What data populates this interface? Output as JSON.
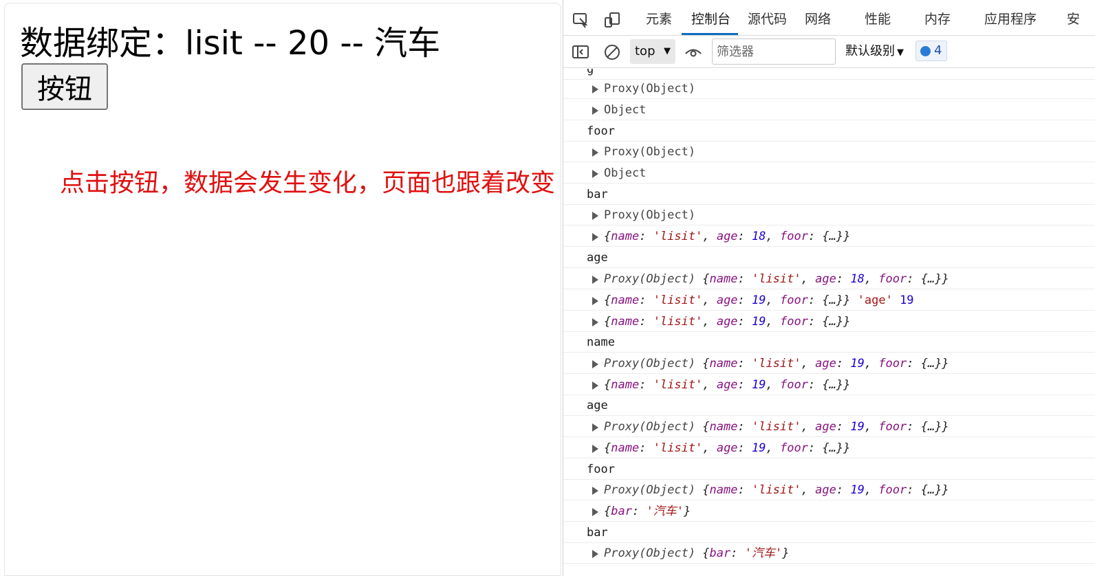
{
  "page": {
    "title_text": "数据绑定：lisit -- 20 -- 汽车",
    "button_label": "按钮",
    "annotation_text": "点击按钮，数据会发生变化，页面也跟着改变"
  },
  "devtools": {
    "tabs": [
      {
        "label": "元素",
        "icon": "elements"
      },
      {
        "label": "控制台",
        "active": true
      },
      {
        "label": "源代码"
      },
      {
        "label": "网络"
      },
      {
        "label": "性能"
      },
      {
        "label": "内存"
      },
      {
        "label": "应用程序"
      },
      {
        "label": "安"
      }
    ],
    "toolbar": {
      "context": "top",
      "filter_placeholder": "筛选器",
      "level": "默认级别",
      "issues_count": "4"
    },
    "console_rows": [
      {
        "kind": "label",
        "text": "g"
      },
      {
        "kind": "obj",
        "text": "Proxy(Object)",
        "style": "plain"
      },
      {
        "kind": "obj",
        "text": "Object",
        "style": "plain"
      },
      {
        "kind": "label",
        "text": "foor"
      },
      {
        "kind": "obj",
        "text": "Proxy(Object)",
        "style": "plain"
      },
      {
        "kind": "obj",
        "text": "Object",
        "style": "plain"
      },
      {
        "kind": "label",
        "text": "bar"
      },
      {
        "kind": "obj",
        "text": "Proxy(Object)",
        "style": "plain"
      },
      {
        "kind": "obj",
        "text": "{name: 'lisit', age: 18, foor: {…}}",
        "style": "obj"
      },
      {
        "kind": "label",
        "text": "age"
      },
      {
        "kind": "obj",
        "text": "Proxy(Object) {name: 'lisit', age: 18, foor: {…}}",
        "style": "proxy"
      },
      {
        "kind": "obj",
        "text": "{name: 'lisit', age: 19, foor: {…}}",
        "style": "obj",
        "extra_str": "'age'",
        "extra_num": "19"
      },
      {
        "kind": "obj",
        "text": "{name: 'lisit', age: 19, foor: {…}}",
        "style": "obj"
      },
      {
        "kind": "label",
        "text": "name"
      },
      {
        "kind": "obj",
        "text": "Proxy(Object) {name: 'lisit', age: 19, foor: {…}}",
        "style": "proxy"
      },
      {
        "kind": "obj",
        "text": "{name: 'lisit', age: 19, foor: {…}}",
        "style": "obj"
      },
      {
        "kind": "label",
        "text": "age"
      },
      {
        "kind": "obj",
        "text": "Proxy(Object) {name: 'lisit', age: 19, foor: {…}}",
        "style": "proxy"
      },
      {
        "kind": "obj",
        "text": "{name: 'lisit', age: 19, foor: {…}}",
        "style": "obj"
      },
      {
        "kind": "label",
        "text": "foor"
      },
      {
        "kind": "obj",
        "text": "Proxy(Object) {name: 'lisit', age: 19, foor: {…}}",
        "style": "proxy"
      },
      {
        "kind": "obj",
        "text": "{bar: '汽车'}",
        "style": "obj"
      },
      {
        "kind": "label",
        "text": "bar"
      },
      {
        "kind": "obj",
        "text": "Proxy(Object) {bar: '汽车'}",
        "style": "proxy"
      }
    ],
    "colors": {
      "key": "#881280",
      "string": "#a31515",
      "number": "#1c00cf",
      "active_tab": "#0f6cbd",
      "annotation": "#e01010"
    }
  }
}
